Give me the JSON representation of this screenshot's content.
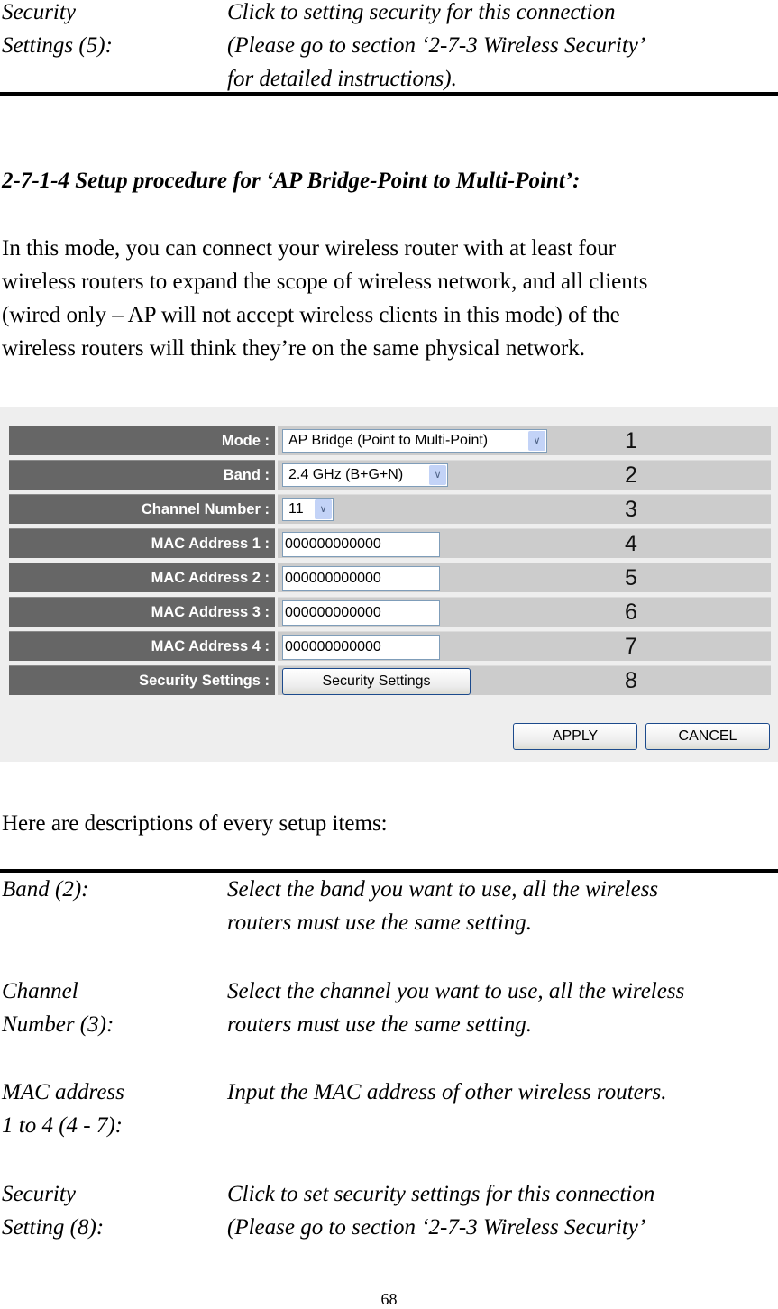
{
  "top_item": {
    "label_lines": [
      "Security",
      "Settings (5):"
    ],
    "desc_lines": [
      "Click to setting security for this connection",
      "(Please go to section ‘2-7-3 Wireless Security’",
      "for detailed instructions)."
    ]
  },
  "section": {
    "heading": "2-7-1-4 Setup procedure for ‘AP Bridge-Point to Multi-Point’:",
    "intro_lines": [
      "In this mode, you can connect your wireless router with at least four",
      "wireless routers to expand the scope of wireless network, and all clients",
      "(wired only – AP will not accept wireless clients in this mode) of the",
      "wireless routers will think they’re on the same physical network."
    ]
  },
  "screenshot": {
    "rows": [
      {
        "label": "Mode :",
        "type": "select",
        "value": "AP Bridge (Point to Multi-Point)",
        "callout": "1"
      },
      {
        "label": "Band :",
        "type": "select",
        "value": "2.4 GHz (B+G+N)",
        "callout": "2"
      },
      {
        "label": "Channel Number :",
        "type": "select",
        "value": "11",
        "callout": "3"
      },
      {
        "label": "MAC Address 1 :",
        "type": "input",
        "value": "000000000000",
        "callout": "4"
      },
      {
        "label": "MAC Address 2 :",
        "type": "input",
        "value": "000000000000",
        "callout": "5"
      },
      {
        "label": "MAC Address 3 :",
        "type": "input",
        "value": "000000000000",
        "callout": "6"
      },
      {
        "label": "MAC Address 4 :",
        "type": "input",
        "value": "000000000000",
        "callout": "7"
      },
      {
        "label": "Security Settings :",
        "type": "button",
        "value": "Security Settings",
        "callout": "8"
      }
    ],
    "dropdown_arrow": "⌵",
    "apply_label": "APPLY",
    "cancel_label": "CANCEL"
  },
  "descriptions_intro": "Here are descriptions of every setup items:",
  "descriptions": [
    {
      "label_lines": [
        "Band (2):"
      ],
      "desc_lines": [
        "Select the band you want to use, all the wireless",
        "routers must use the same setting."
      ]
    },
    {
      "label_lines": [
        "Channel",
        "Number (3):"
      ],
      "desc_lines": [
        "Select the channel you want to use, all the wireless",
        "routers must use the same setting."
      ]
    },
    {
      "label_lines": [
        "MAC address",
        "1 to 4 (4 - 7):"
      ],
      "desc_lines": [
        "Input the MAC address of other wireless routers."
      ]
    },
    {
      "label_lines": [
        "Security",
        "Setting (8):"
      ],
      "desc_lines": [
        "Click to set security settings for this connection",
        "(Please go to section ‘2-7-3 Wireless Security’"
      ]
    }
  ],
  "page_number": "68"
}
